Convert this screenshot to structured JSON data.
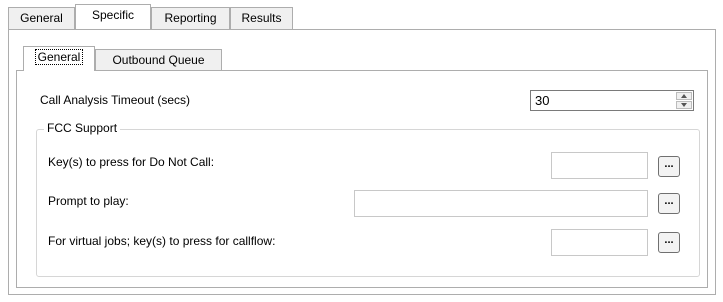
{
  "outer_tabs": [
    {
      "label": "General",
      "active": false
    },
    {
      "label": "Specific",
      "active": true
    },
    {
      "label": "Reporting",
      "active": false
    },
    {
      "label": "Results",
      "active": false
    }
  ],
  "inner_tabs": [
    {
      "label": "General",
      "active": true
    },
    {
      "label": "Outbound Queue",
      "active": false
    }
  ],
  "call_analysis": {
    "label": "Call Analysis Timeout (secs)",
    "value": "30"
  },
  "fcc": {
    "title": "FCC Support",
    "dnc_label": "Key(s) to press for Do Not Call:",
    "dnc_value": "",
    "prompt_label": "Prompt to play:",
    "prompt_value": "",
    "virtual_label": "For virtual jobs; key(s) to press for callflow:",
    "virtual_value": "",
    "browse_label": "..."
  }
}
